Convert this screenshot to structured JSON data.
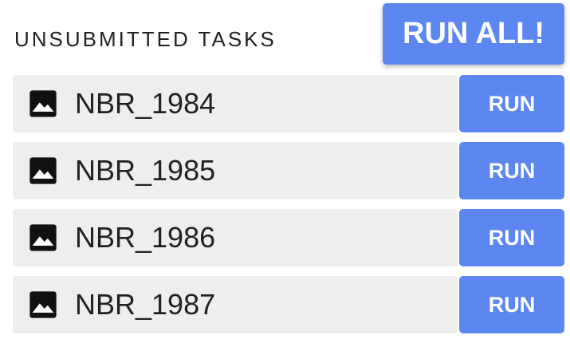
{
  "header": {
    "title": "UNSUBMITTED TASKS",
    "run_all_label": "RUN ALL!"
  },
  "tasks": [
    {
      "name": "NBR_1984",
      "icon": "image-icon",
      "run_label": "RUN"
    },
    {
      "name": "NBR_1985",
      "icon": "image-icon",
      "run_label": "RUN"
    },
    {
      "name": "NBR_1986",
      "icon": "image-icon",
      "run_label": "RUN"
    },
    {
      "name": "NBR_1987",
      "icon": "image-icon",
      "run_label": "RUN"
    }
  ],
  "colors": {
    "accent": "#5d87f0",
    "row_background": "#eeeeee",
    "text": "#212121"
  }
}
